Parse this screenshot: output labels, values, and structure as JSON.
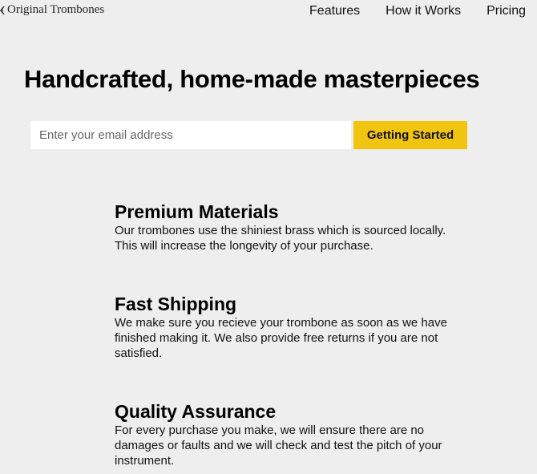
{
  "header": {
    "logo_text": "Original Trombones",
    "logo_icon": "trombone-logo-icon",
    "nav": [
      {
        "label": "Features"
      },
      {
        "label": "How it Works"
      },
      {
        "label": "Pricing"
      }
    ]
  },
  "hero": {
    "title": "Handcrafted, home-made masterpieces",
    "email_placeholder": "Enter your email address",
    "cta_label": "Getting Started",
    "cta_color": "#f1c40f"
  },
  "features": [
    {
      "title": "Premium Materials",
      "text": "Our trombones use the shiniest brass which is sourced locally. This will increase the longevity of your purchase."
    },
    {
      "title": "Fast Shipping",
      "text": "We make sure you recieve your trombone as soon as we have finished making it. We also provide free returns if you are not satisfied."
    },
    {
      "title": "Quality Assurance",
      "text": "For every purchase you make, we will ensure there are no damages or faults and we will check and test the pitch of your instrument."
    }
  ]
}
